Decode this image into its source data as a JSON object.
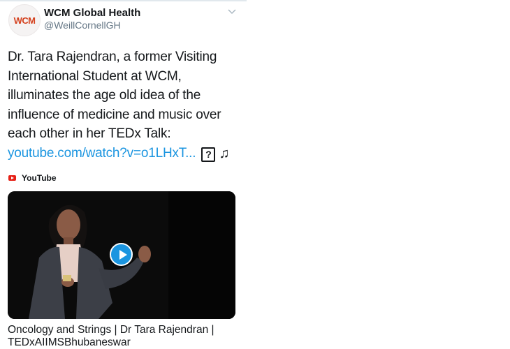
{
  "account": {
    "avatar_text": "WCM",
    "name": "WCM Global Health",
    "handle": "@WeillCornellGH"
  },
  "tweet": {
    "text": "Dr. Tara Rajendran, a former Visiting International Student at WCM, illuminates the age old idea of the influence of medicine and music over each other in her TEDx Talk: ",
    "link_text": "youtube.com/watch?v=o1LHxT...",
    "emoji_box": "?",
    "emoji_note": "♫"
  },
  "card": {
    "source_icon": "youtube-icon",
    "source_label": "YouTube",
    "video_title": "Oncology and Strings | Dr Tara Rajendran | TEDxAIIMSBhubaneswar"
  },
  "colors": {
    "accent": "#1b95e0",
    "brand": "#d4411e",
    "youtube": "#e62117"
  }
}
